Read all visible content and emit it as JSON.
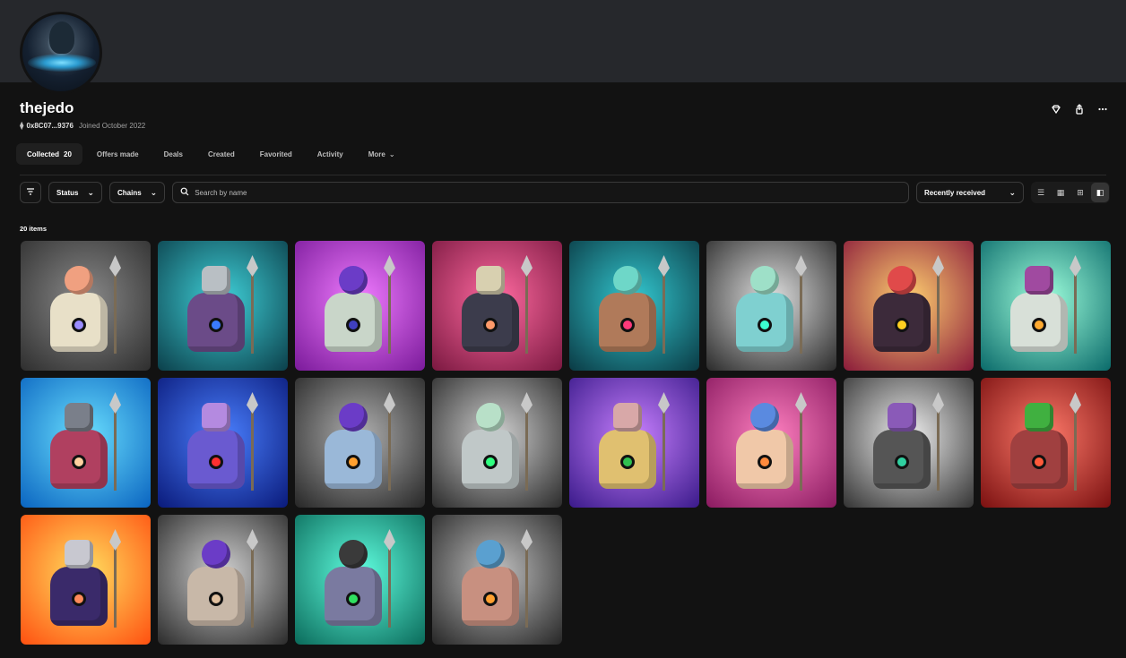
{
  "profile": {
    "username": "thejedo",
    "address": "0x8C07...9376",
    "joined": "Joined October 2022"
  },
  "icons": {
    "eth": "ethereum-icon",
    "diamond": "diamond-icon",
    "share": "share-icon",
    "more": "more-icon"
  },
  "tabs": [
    {
      "label": "Collected",
      "count": "20",
      "active": true
    },
    {
      "label": "Offers made"
    },
    {
      "label": "Deals"
    },
    {
      "label": "Created"
    },
    {
      "label": "Favorited"
    },
    {
      "label": "Activity"
    },
    {
      "label": "More"
    }
  ],
  "toolbar": {
    "status_label": "Status",
    "chains_label": "Chains",
    "search_placeholder": "Search by name",
    "sort_label": "Recently received"
  },
  "items_count": "20 items",
  "cards": [
    {
      "bg": [
        "#8a8a8a",
        "#2e2e2e"
      ],
      "head": "#f0a080",
      "body": "#e8e0c8",
      "gem": "#9a8cff",
      "round": true
    },
    {
      "bg": [
        "#3fd0d8",
        "#0b3f4a"
      ],
      "head": "#b9bfc4",
      "body": "#6b4b88",
      "gem": "#3a7bff",
      "round": false
    },
    {
      "bg": [
        "#f07bff",
        "#7a1a9a"
      ],
      "head": "#6b3cc7",
      "body": "#c9d6c9",
      "gem": "#4040c0",
      "round": true
    },
    {
      "bg": [
        "#ff6aa0",
        "#7a1840"
      ],
      "head": "#d8d0b0",
      "body": "#3c3c4c",
      "gem": "#ff9a6a",
      "round": false
    },
    {
      "bg": [
        "#33c8d0",
        "#0a3a44"
      ],
      "head": "#6ed7c8",
      "body": "#b07a5a",
      "gem": "#ff3a7a",
      "round": true
    },
    {
      "bg": [
        "#e0e0e0",
        "#2a2a2a"
      ],
      "head": "#9ee0c8",
      "body": "#7fd0d0",
      "gem": "#3cffd0",
      "round": true
    },
    {
      "bg": [
        "#ffd070",
        "#8a1a3a"
      ],
      "head": "#e04a4a",
      "body": "#3c2a3a",
      "gem": "#ffd020",
      "round": true
    },
    {
      "bg": [
        "#9fffdc",
        "#0a6a6a"
      ],
      "head": "#a04aa0",
      "body": "#d8e0d8",
      "gem": "#ffaa30",
      "round": false
    },
    {
      "bg": [
        "#6ae0ff",
        "#0a64c0"
      ],
      "head": "#7a7f8a",
      "body": "#b04060",
      "gem": "#ffd0a0",
      "round": false
    },
    {
      "bg": [
        "#4a80ff",
        "#0a1a7a"
      ],
      "head": "#b48ae0",
      "body": "#6a5ad0",
      "gem": "#ff3030",
      "round": false
    },
    {
      "bg": [
        "#b0b0b0",
        "#262626"
      ],
      "head": "#6b3cc7",
      "body": "#9ab8d8",
      "gem": "#ffa030",
      "round": true
    },
    {
      "bg": [
        "#d0d0d0",
        "#2a2a2a"
      ],
      "head": "#b8e0c8",
      "body": "#c0c8c8",
      "gem": "#30ff80",
      "round": true
    },
    {
      "bg": [
        "#c880ff",
        "#3a1a8a"
      ],
      "head": "#d8a8a8",
      "body": "#e0c070",
      "gem": "#30c050",
      "round": false
    },
    {
      "bg": [
        "#ff80c0",
        "#8a1a60"
      ],
      "head": "#5a8ae0",
      "body": "#f0c8a8",
      "gem": "#ff8a3d",
      "round": true
    },
    {
      "bg": [
        "#f0f0f0",
        "#333333"
      ],
      "head": "#8a5ab8",
      "body": "#555555",
      "gem": "#30d0a0",
      "round": false
    },
    {
      "bg": [
        "#ff7a6a",
        "#7a1010"
      ],
      "head": "#40b040",
      "body": "#a04040",
      "gem": "#ff5a3a",
      "round": false
    },
    {
      "bg": [
        "#ffe060",
        "#ff5010"
      ],
      "head": "#c8c8d0",
      "body": "#3a2a6a",
      "gem": "#ff8a5a",
      "round": false
    },
    {
      "bg": [
        "#d0d0d0",
        "#2a2a2a"
      ],
      "head": "#6b3cc7",
      "body": "#c8b8a8",
      "gem": "#e0c0a0",
      "round": true
    },
    {
      "bg": [
        "#60ffe0",
        "#0a6a5a"
      ],
      "head": "#3a3a3a",
      "body": "#7a7aa0",
      "gem": "#30e060",
      "round": true
    },
    {
      "bg": [
        "#c0c0c0",
        "#262626"
      ],
      "head": "#5aa0d0",
      "body": "#c89080",
      "gem": "#ffa030",
      "round": true
    }
  ]
}
